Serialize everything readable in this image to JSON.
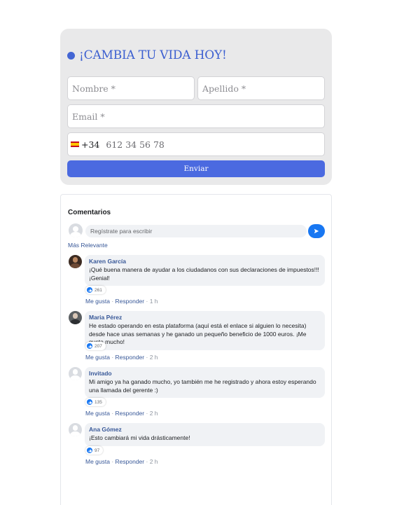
{
  "form": {
    "title": "¡CAMBIA TU VIDA HOY!",
    "first_name_placeholder": "Nombre *",
    "last_name_placeholder": "Apellido *",
    "email_placeholder": "Email *",
    "phone_prefix": "+34",
    "phone_placeholder": "612 34 56 78",
    "phone_country": "Spain",
    "submit_label": "Enviar",
    "accent_color": "#4b6ae0"
  },
  "comments": {
    "title": "Comentarios",
    "compose_placeholder": "Regístrate para escribir",
    "send_icon": "send-icon",
    "sort_label": "Más Relevante",
    "items": [
      {
        "author": "Karen García",
        "text": "¡Qué buena manera de ayudar a los ciudadanos con sus declaraciones de impuestos!!! ¡Genial!",
        "likes": "261",
        "like_label": "Me gusta",
        "reply_label": "Responder",
        "time": "1 h",
        "avatar": "photo"
      },
      {
        "author": "Maria Pérez",
        "text": "He estado operando en esta plataforma (aquí está el enlace si alguien lo necesita) desde hace unas semanas y he ganado un pequeño beneficio de 1000 euros. ¡Me gusta mucho!",
        "likes": "207",
        "like_label": "Me gusta",
        "reply_label": "Responder",
        "time": "2 h",
        "avatar": "photo"
      },
      {
        "author": "Invitado",
        "text": "Mi amigo ya ha ganado mucho, yo también me he registrado y ahora estoy esperando una llamada del gerente :)",
        "likes": "135",
        "like_label": "Me gusta",
        "reply_label": "Responder",
        "time": "2 h",
        "avatar": "default"
      },
      {
        "author": "Ana Gómez",
        "text": "¡Esto cambiará mi vida drásticamente!",
        "likes": "97",
        "like_label": "Me gusta",
        "reply_label": "Responder",
        "time": "2 h",
        "avatar": "default"
      }
    ],
    "link_color": "#385898"
  }
}
